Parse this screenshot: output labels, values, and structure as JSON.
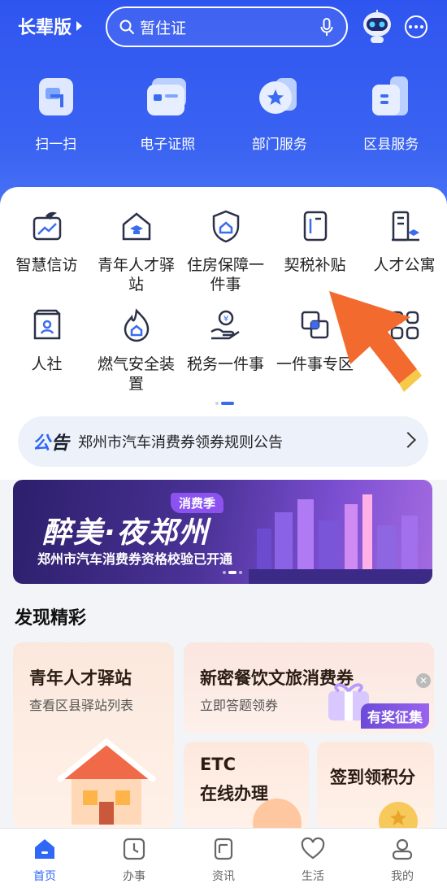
{
  "header": {
    "mode_label": "长辈版",
    "search_placeholder": "暂住证"
  },
  "quick_actions": [
    {
      "label": "扫一扫",
      "icon": "scan-icon"
    },
    {
      "label": "电子证照",
      "icon": "id-card-icon"
    },
    {
      "label": "部门服务",
      "icon": "star-badge-icon"
    },
    {
      "label": "区县服务",
      "icon": "building-icon"
    }
  ],
  "services": [
    {
      "label": "智慧信访",
      "icon": "chart-petition-icon"
    },
    {
      "label": "青年人才驿站",
      "icon": "graduate-house-icon"
    },
    {
      "label": "住房保障一件事",
      "icon": "house-shield-icon"
    },
    {
      "label": "契税补贴",
      "icon": "document-icon"
    },
    {
      "label": "人才公寓",
      "icon": "apartment-icon"
    },
    {
      "label": "人社",
      "icon": "social-security-icon"
    },
    {
      "label": "燃气安全装置",
      "icon": "flame-icon"
    },
    {
      "label": "税务一件事",
      "icon": "tax-hand-icon"
    },
    {
      "label": "一件事专区",
      "icon": "overlap-squares-icon"
    },
    {
      "label": "",
      "icon": "grid-more-icon"
    }
  ],
  "notice": {
    "tag_a": "公",
    "tag_b": "告",
    "text": "郑州市汽车消费券领券规则公告"
  },
  "banner": {
    "badge": "消费季",
    "title": "醉美·夜郑州",
    "subtitle": "郑州市汽车消费券资格校验已开通"
  },
  "discover": {
    "title": "发现精彩",
    "tiles": [
      {
        "title": "青年人才驿站",
        "subtitle": "查看区县驿站列表"
      },
      {
        "title": "新密餐饮文旅消费券",
        "subtitle": "立即答题领券",
        "award": "有奖征集"
      },
      {
        "title": "ETC\n在线办理",
        "line1": "ETC",
        "line2": "在线办理"
      },
      {
        "title": "签到领积分"
      }
    ]
  },
  "tabbar": [
    {
      "label": "首页",
      "icon": "home-icon",
      "active": true
    },
    {
      "label": "办事",
      "icon": "clock-icon"
    },
    {
      "label": "资讯",
      "icon": "news-icon"
    },
    {
      "label": "生活",
      "icon": "heart-icon"
    },
    {
      "label": "我的",
      "icon": "profile-icon"
    }
  ],
  "colors": {
    "brand_blue": "#2f55f0",
    "accent_blue": "#2f67f6",
    "pointer_orange": "#f26a2e"
  }
}
